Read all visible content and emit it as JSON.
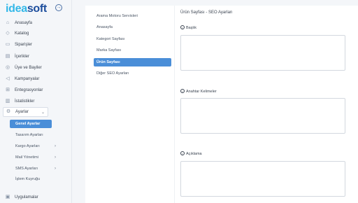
{
  "brand": {
    "part1": "idea",
    "part2": "soft"
  },
  "sidebar": {
    "items": [
      {
        "label": "Anasayfa",
        "icon": "home-icon"
      },
      {
        "label": "Katalog",
        "icon": "tag-icon"
      },
      {
        "label": "Siparişler",
        "icon": "cart-icon"
      },
      {
        "label": "İçerikler",
        "icon": "document-icon"
      },
      {
        "label": "Üye ve Bayiler",
        "icon": "users-icon"
      },
      {
        "label": "Kampanyalar",
        "icon": "megaphone-icon"
      },
      {
        "label": "Entegrasyonlar",
        "icon": "integration-icon"
      },
      {
        "label": "İstatistikler",
        "icon": "stats-icon"
      },
      {
        "label": "Ayarlar",
        "icon": "gear-icon"
      }
    ],
    "settings_sub": [
      {
        "label": "Genel Ayarlar"
      },
      {
        "label": "Tasarım Ayarları"
      },
      {
        "label": "Kargo Ayarları"
      },
      {
        "label": "Mail Yönetimi"
      },
      {
        "label": "SMS Ayarları"
      },
      {
        "label": "İşlem Kuyruğu"
      }
    ],
    "apps": {
      "label": "Uygulamalar",
      "icon": "apps-icon"
    }
  },
  "seo_menu": [
    {
      "label": "Arama Motoru Servisleri"
    },
    {
      "label": "Anasayfa"
    },
    {
      "label": "Kategori Sayfası"
    },
    {
      "label": "Marka Sayfası"
    },
    {
      "label": "Ürün Sayfası"
    },
    {
      "label": "Diğer SEO Ayarları"
    }
  ],
  "form": {
    "title": "Ürün Sayfası - SEO Ayarları",
    "fields": [
      {
        "label": "Başlık",
        "value": ""
      },
      {
        "label": "Anahtar Kelimeler",
        "value": ""
      },
      {
        "label": "Açıklama",
        "value": ""
      }
    ]
  },
  "colors": {
    "accent": "#4a8ed8",
    "brand_light": "#33b8e8",
    "brand_dark": "#1c4d9c"
  }
}
